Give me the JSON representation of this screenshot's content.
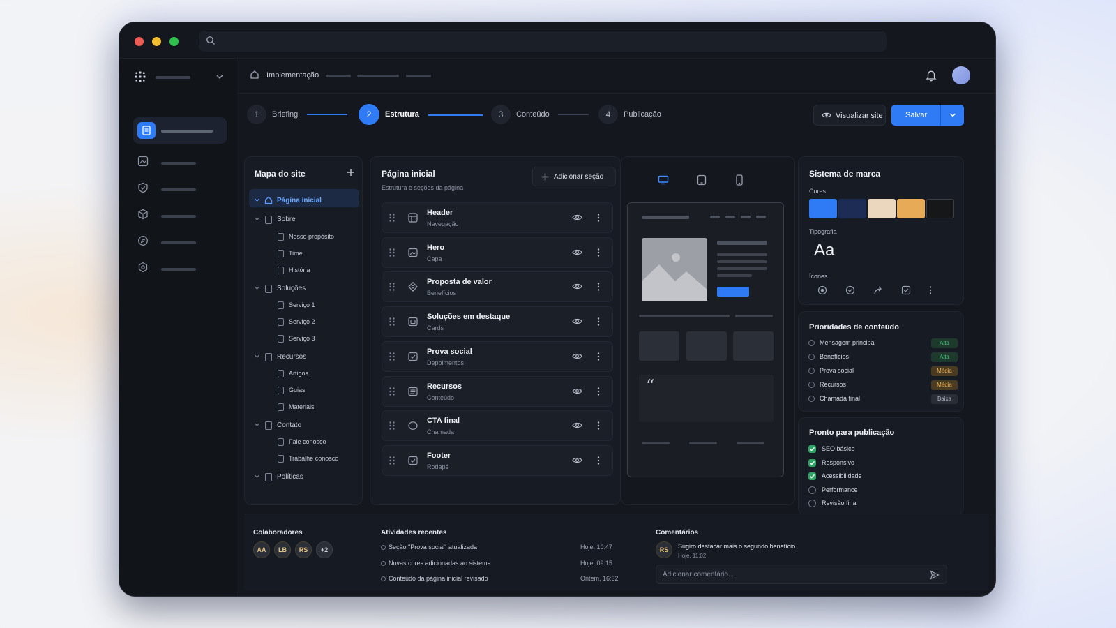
{
  "breadcrumb": {
    "label": "Implementação"
  },
  "steps": [
    {
      "num": "1",
      "label": "Briefing"
    },
    {
      "num": "2",
      "label": "Estrutura"
    },
    {
      "num": "3",
      "label": "Conteúdo"
    },
    {
      "num": "4",
      "label": "Publicação"
    }
  ],
  "actions": {
    "preview_label": "Visualizar site",
    "save_label": "Salvar"
  },
  "sitemap": {
    "title": "Mapa do site",
    "items": [
      {
        "label": "Página inicial"
      },
      {
        "label": "Sobre"
      },
      {
        "label": "Nosso propósito"
      },
      {
        "label": "Time"
      },
      {
        "label": "História"
      },
      {
        "label": "Soluções"
      },
      {
        "label": "Serviço 1"
      },
      {
        "label": "Serviço 2"
      },
      {
        "label": "Serviço 3"
      },
      {
        "label": "Recursos"
      },
      {
        "label": "Artigos"
      },
      {
        "label": "Guias"
      },
      {
        "label": "Materiais"
      },
      {
        "label": "Contato"
      },
      {
        "label": "Fale conosco"
      },
      {
        "label": "Trabalhe conosco"
      },
      {
        "label": "Políticas"
      }
    ]
  },
  "page": {
    "title": "Página inicial",
    "subtitle": "Estrutura e seções da página",
    "add_section_label": "Adicionar seção",
    "sections": [
      {
        "title": "Header",
        "sub": "Navegação"
      },
      {
        "title": "Hero",
        "sub": "Capa"
      },
      {
        "title": "Proposta de valor",
        "sub": "Benefícios"
      },
      {
        "title": "Soluções em destaque",
        "sub": "Cards"
      },
      {
        "title": "Prova social",
        "sub": "Depoimentos"
      },
      {
        "title": "Recursos",
        "sub": "Conteúdo"
      },
      {
        "title": "CTA final",
        "sub": "Chamada"
      },
      {
        "title": "Footer",
        "sub": "Rodapé"
      }
    ]
  },
  "preview": {
    "quote_glyph": "“"
  },
  "brand": {
    "title": "Sistema de marca",
    "colors_label": "Cores",
    "colors": [
      "#2f7bf5",
      "#1c2c55",
      "#ead7bd",
      "#e7ab58",
      "#151719"
    ],
    "typography_label": "Tipografia",
    "typography_sample": "Aa",
    "icons_label": "Ícones"
  },
  "priorities": {
    "title": "Prioridades de conteúdo",
    "items": [
      {
        "label": "Mensagem principal",
        "badge": "Alta",
        "level": "alta"
      },
      {
        "label": "Benefícios",
        "badge": "Alta",
        "level": "alta"
      },
      {
        "label": "Prova social",
        "badge": "Média",
        "level": "media"
      },
      {
        "label": "Recursos",
        "badge": "Média",
        "level": "media"
      },
      {
        "label": "Chamada final",
        "badge": "Baixa",
        "level": "baixa"
      }
    ]
  },
  "publish": {
    "title": "Pronto para publicação",
    "items": [
      {
        "label": "SEO básico",
        "done": true
      },
      {
        "label": "Responsivo",
        "done": true
      },
      {
        "label": "Acessibilidade",
        "done": true
      },
      {
        "label": "Performance",
        "done": false
      },
      {
        "label": "Revisão final",
        "done": false
      }
    ]
  },
  "collaborators": {
    "title": "Colaboradores",
    "people": [
      "AA",
      "LB",
      "RS"
    ],
    "more": "+2"
  },
  "activities": {
    "title": "Atividades recentes",
    "items": [
      {
        "text": "Seção \"Prova social\" atualizada",
        "time": "Hoje, 10:47"
      },
      {
        "text": "Novas cores adicionadas ao sistema",
        "time": "Hoje, 09:15"
      },
      {
        "text": "Conteúdo da página inicial revisado",
        "time": "Ontem, 16:32"
      }
    ]
  },
  "comments": {
    "title": "Comentários",
    "items": [
      {
        "author": "RS",
        "text": "Sugiro destacar mais o segundo benefício.",
        "time": "Hoje, 11:02"
      }
    ],
    "input_placeholder": "Adicionar comentário..."
  },
  "colors": {
    "accent": "#2f7bf5",
    "traffic_red": "#ef5b55",
    "traffic_yellow": "#f2bd2f",
    "traffic_green": "#2fc14d",
    "badge_alta_bg": "#1d3a2c",
    "badge_alta_fg": "#57c98a",
    "badge_media_bg": "#4a3a1f",
    "badge_media_fg": "#e6b15c",
    "badge_baixa_bg": "#2a2e37",
    "badge_baixa_fg": "#b7bdc9"
  }
}
